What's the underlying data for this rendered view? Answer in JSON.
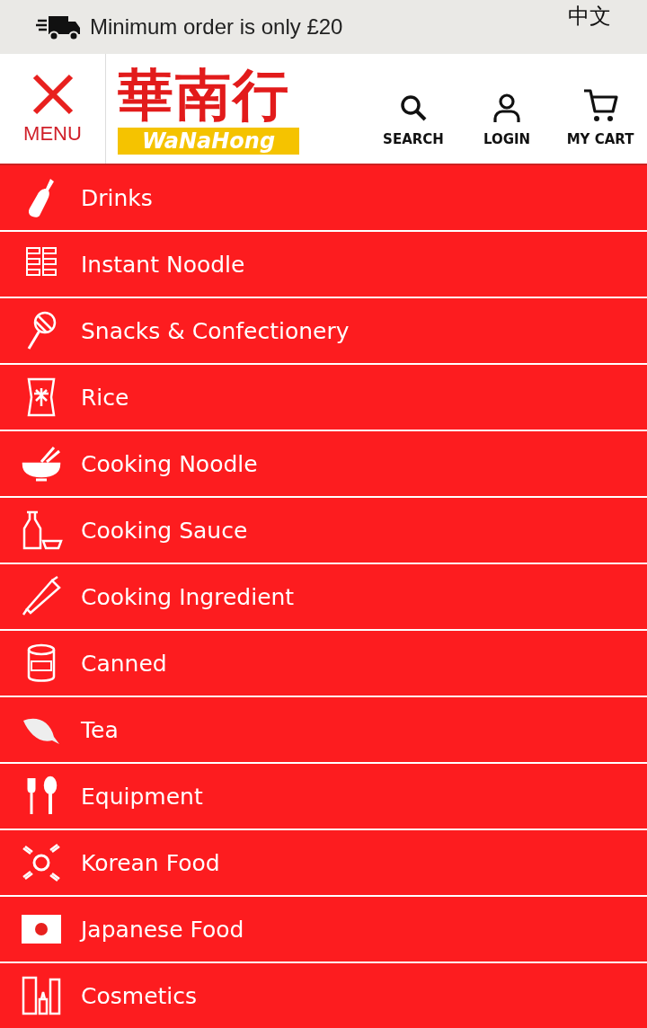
{
  "top_bar": {
    "notice": "Minimum order is only £20",
    "language": "中文"
  },
  "header": {
    "menu_label": "MENU",
    "logo": {
      "chinese": "華南行",
      "latin": "WaNaHong"
    },
    "actions": [
      {
        "kind": "search",
        "label": "SEARCH"
      },
      {
        "kind": "login",
        "label": "LOGIN"
      },
      {
        "kind": "cart",
        "label": "MY CART"
      }
    ]
  },
  "categories": [
    {
      "kind": "bottle",
      "label": "Drinks"
    },
    {
      "kind": "noodle",
      "label": "Instant Noodle"
    },
    {
      "kind": "lollipop",
      "label": "Snacks & Confectionery"
    },
    {
      "kind": "sack",
      "label": "Rice"
    },
    {
      "kind": "bowl",
      "label": "Cooking Noodle"
    },
    {
      "kind": "sauce",
      "label": "Cooking Sauce"
    },
    {
      "kind": "rollingpin",
      "label": "Cooking Ingredient"
    },
    {
      "kind": "can",
      "label": "Canned"
    },
    {
      "kind": "leaf",
      "label": "Tea"
    },
    {
      "kind": "cutlery",
      "label": "Equipment"
    },
    {
      "kind": "korea",
      "label": "Korean Food"
    },
    {
      "kind": "japan",
      "label": "Japanese Food"
    },
    {
      "kind": "cosmetic",
      "label": "Cosmetics"
    }
  ]
}
